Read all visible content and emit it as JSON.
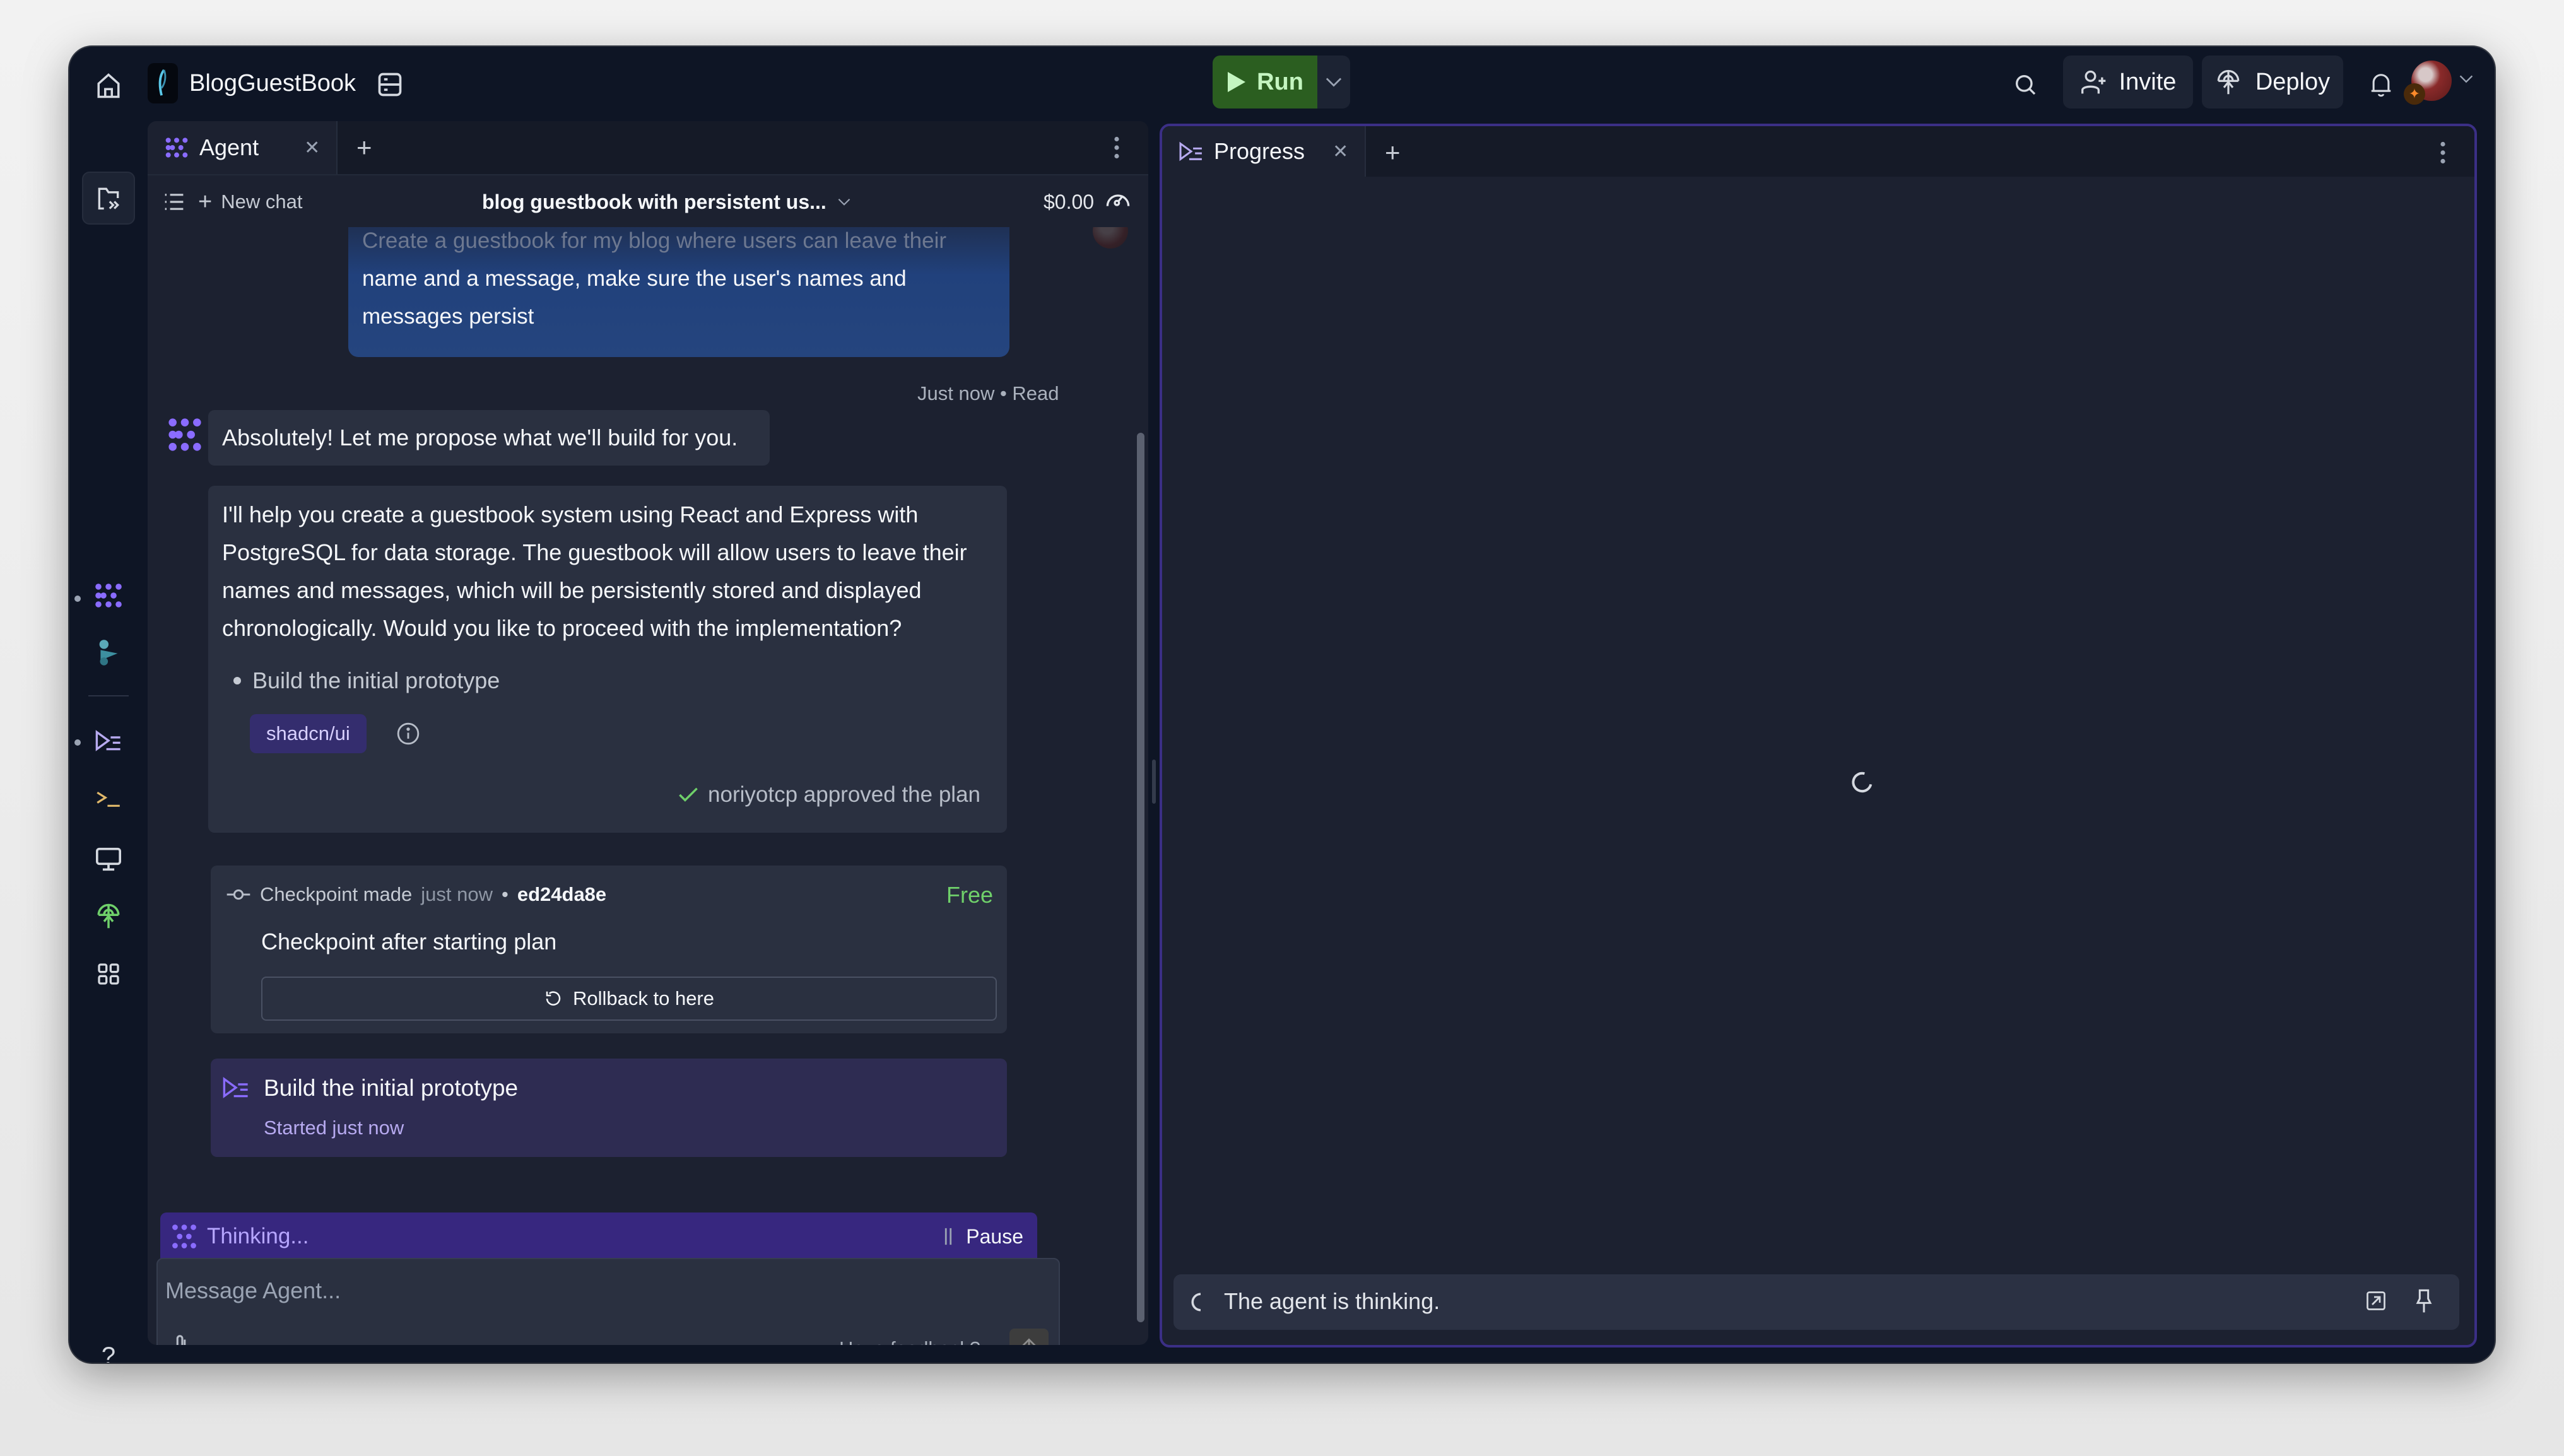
{
  "topbar": {
    "app_title": "BlogGuestBook",
    "run_label": "Run",
    "invite_label": "Invite",
    "deploy_label": "Deploy",
    "icons": [
      "home-icon",
      "replit-logo",
      "database-icon",
      "play-icon",
      "chevron-down-icon",
      "search-icon",
      "add-user-icon",
      "deploy-globe-icon",
      "bell-icon",
      "sparkle-icon",
      "avatar"
    ]
  },
  "rail": {
    "items": [
      {
        "name": "files",
        "icon": "folder-icon"
      },
      {
        "name": "agent",
        "icon": "agent-icon",
        "active_dot": true
      },
      {
        "name": "assistant",
        "icon": "assistant-icon"
      },
      {
        "name": "progress",
        "icon": "progress-icon",
        "active_dot": true
      },
      {
        "name": "shell",
        "icon": "terminal-icon"
      },
      {
        "name": "webview",
        "icon": "monitor-icon"
      },
      {
        "name": "deployments",
        "icon": "deploy-globe-icon"
      },
      {
        "name": "all-tools",
        "icon": "grid-icon"
      }
    ],
    "help_label": "?"
  },
  "agent_panel": {
    "tab_label": "Agent",
    "chat_header": {
      "new_chat_label": "New chat",
      "chat_title": "blog guestbook with persistent us...",
      "cost": "$0.00"
    },
    "user_message": {
      "line1": "Create a guestbook for my blog where users can leave their",
      "line2": "name and a message, make sure the user's names and",
      "line3": "messages persist",
      "meta": "Just now • Read"
    },
    "agent_short_reply": "Absolutely! Let me propose what we'll build for you.",
    "plan": {
      "text": "I'll help you create a guestbook system using React and Express with PostgreSQL for data storage. The guestbook will allow users to leave their names and messages, which will be persistently stored and displayed chronologically. Would you like to proceed with the implementation?",
      "bullet": "Build the initial prototype",
      "chip": "shadcn/ui",
      "approved_text": "noriyotcp approved the plan"
    },
    "checkpoint": {
      "label": "Checkpoint made",
      "time": "just now",
      "separator": "•",
      "hash": "ed24da8e",
      "price": "Free",
      "title": "Checkpoint after starting plan",
      "rollback_label": "Rollback to here"
    },
    "build_step": {
      "title": "Build the initial prototype",
      "subtitle": "Started just now"
    },
    "thinking": {
      "label": "Thinking...",
      "pause_label": "Pause"
    },
    "composer": {
      "placeholder": "Message Agent...",
      "value": "",
      "feedback_label": "Have feedback?"
    }
  },
  "progress_panel": {
    "tab_label": "Progress",
    "status_text": "The agent is thinking."
  }
}
